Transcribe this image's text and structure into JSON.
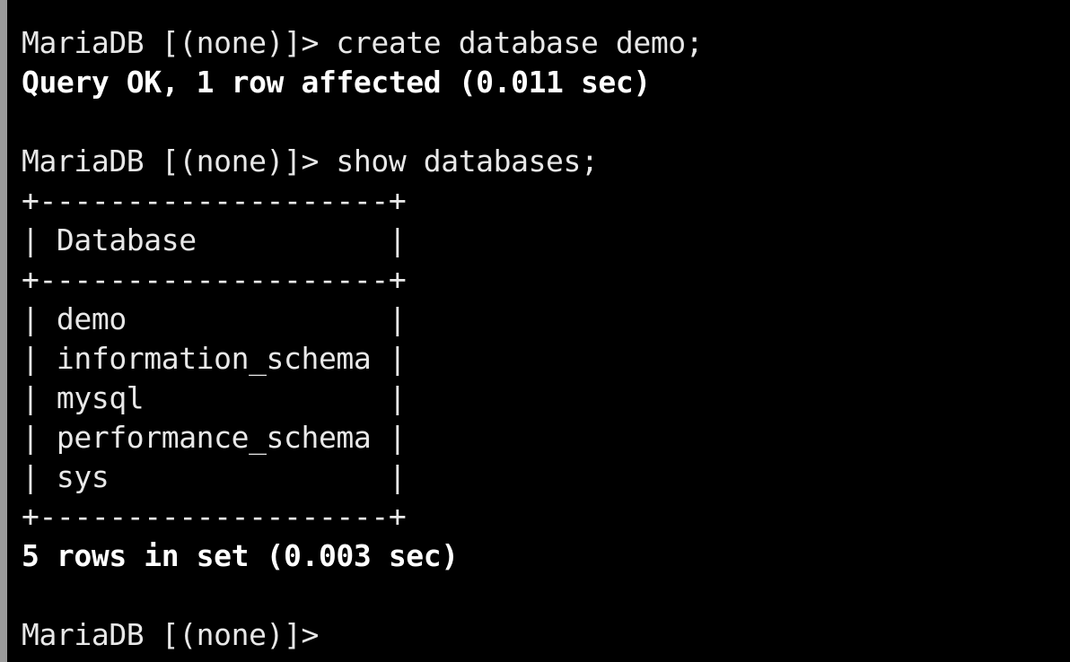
{
  "terminal": {
    "prompt": "MariaDB [(none)]>",
    "lines": [
      {
        "prompt": "MariaDB [(none)]>",
        "command": " create database demo;"
      },
      {
        "text": "Query OK, 1 row affected (0.011 sec)"
      },
      {
        "text": ""
      },
      {
        "prompt": "MariaDB [(none)]>",
        "command": " show databases;"
      },
      {
        "text": "+--------------------+"
      },
      {
        "text": "| Database           |"
      },
      {
        "text": "+--------------------+"
      },
      {
        "text": "| demo               |"
      },
      {
        "text": "| information_schema |"
      },
      {
        "text": "| mysql              |"
      },
      {
        "text": "| performance_schema |"
      },
      {
        "text": "| sys                |"
      },
      {
        "text": "+--------------------+"
      },
      {
        "text": "5 rows in set (0.003 sec)"
      },
      {
        "text": ""
      },
      {
        "prompt": "MariaDB [(none)]>",
        "command": ""
      }
    ]
  },
  "colors": {
    "background": "#000000",
    "text": "#e8e8e8",
    "bold_text": "#ffffff",
    "left_border": "#9b9b9b"
  }
}
